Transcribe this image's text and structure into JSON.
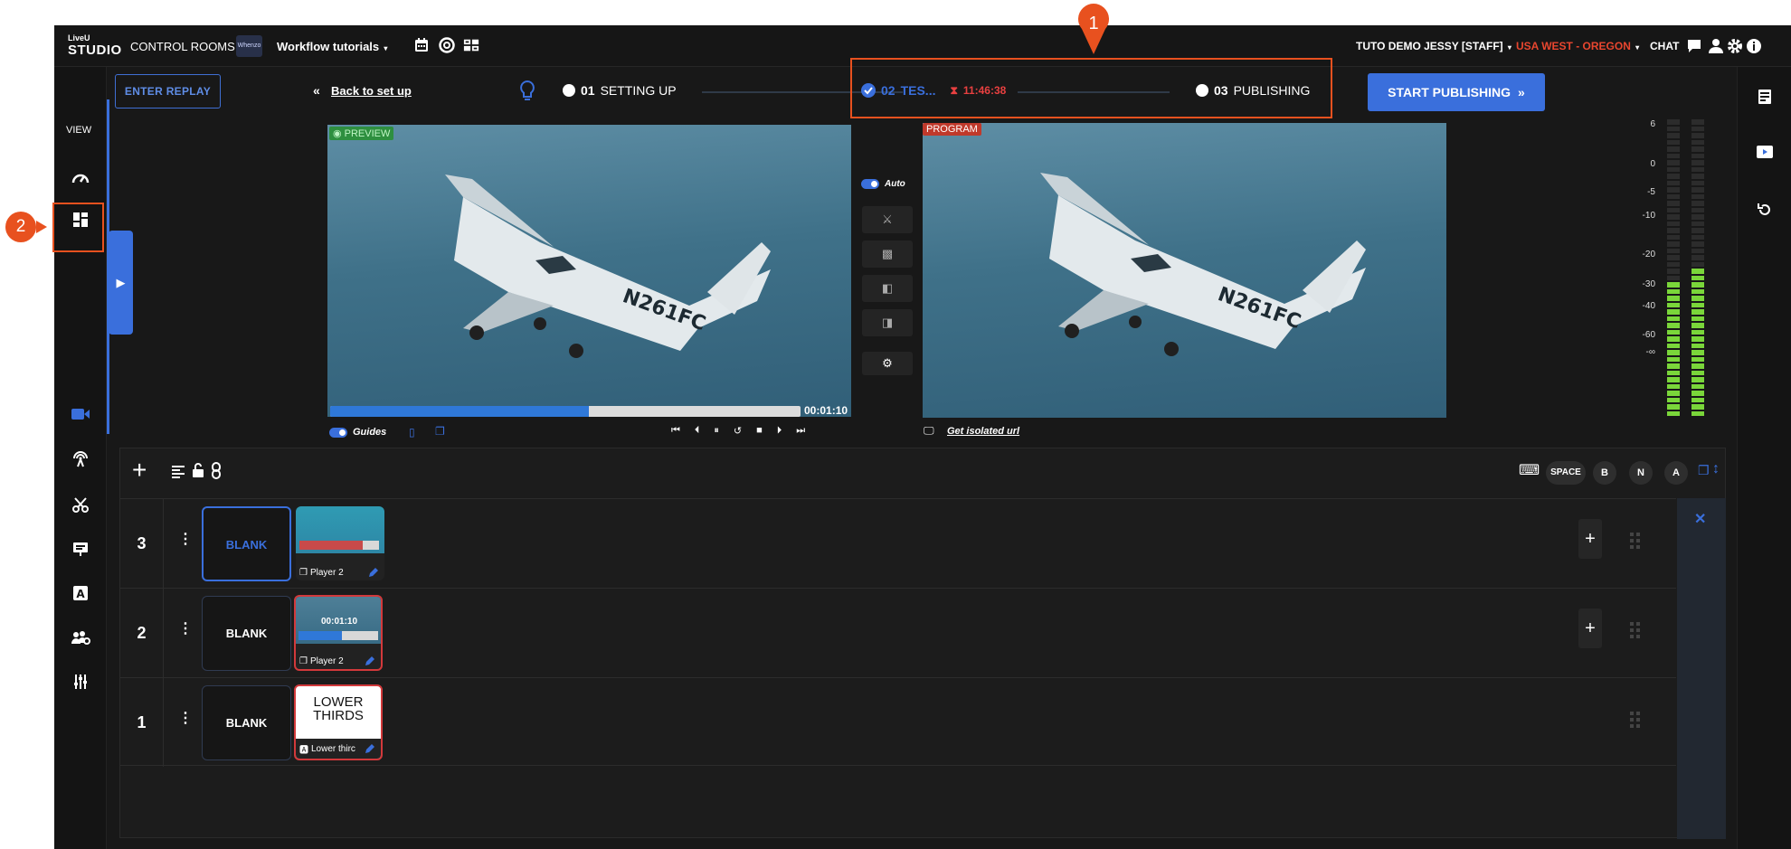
{
  "topbar": {
    "logo_top": "LiveU",
    "logo_bottom": "STUDIO",
    "control_rooms": "CONTROL ROOMS",
    "workspace_thumb": "Whenzo",
    "workspace": "Workflow tutorials",
    "user": "TUTO DEMO JESSY [STAFF]",
    "region": "USA WEST - OREGON",
    "chat": "CHAT"
  },
  "leftrail": {
    "view_label": "VIEW"
  },
  "status": {
    "enter_replay": "ENTER REPLAY",
    "back_link": "Back to set up",
    "step1_num": "01",
    "step1_label": "SETTING UP",
    "step2_num": "02",
    "step2_label": "TES...",
    "step2_timer": "11:46:38",
    "step3_num": "03",
    "step3_label": "PUBLISHING",
    "start_publishing": "START PUBLISHING"
  },
  "preview": {
    "tag": "PREVIEW",
    "progress": 0.55,
    "timecode": "00:01:10",
    "guides_label": "Guides"
  },
  "program": {
    "tag": "PROGRAM",
    "isolated_url": "Get isolated url"
  },
  "aircraft_reg": "N261FC",
  "transitions": {
    "auto_label": "Auto"
  },
  "meters": {
    "scale": [
      "6",
      "0",
      "-5",
      "-10",
      "-20",
      "-30",
      "-40",
      "-60",
      "-∞"
    ],
    "level_left": 0.45,
    "level_right": 0.48
  },
  "panel": {
    "shortcuts": [
      "SPACE",
      "B",
      "N",
      "A"
    ],
    "rows": [
      {
        "num": "3",
        "blank": "BLANK",
        "clip_label": "Player 2",
        "clip_time": ""
      },
      {
        "num": "2",
        "blank": "BLANK",
        "clip_label": "Player 2",
        "clip_time": "00:01:10"
      },
      {
        "num": "1",
        "blank": "BLANK",
        "clip_label": "Lower thirc",
        "clip_title": "LOWER THIRDS"
      }
    ]
  },
  "annotations": {
    "marker1": "1",
    "marker2": "2"
  },
  "colors": {
    "accent": "#3a6fdc",
    "region": "#e8462f",
    "timer": "#e84040",
    "annotation": "#e8511f",
    "meter": "#7ad63a"
  }
}
